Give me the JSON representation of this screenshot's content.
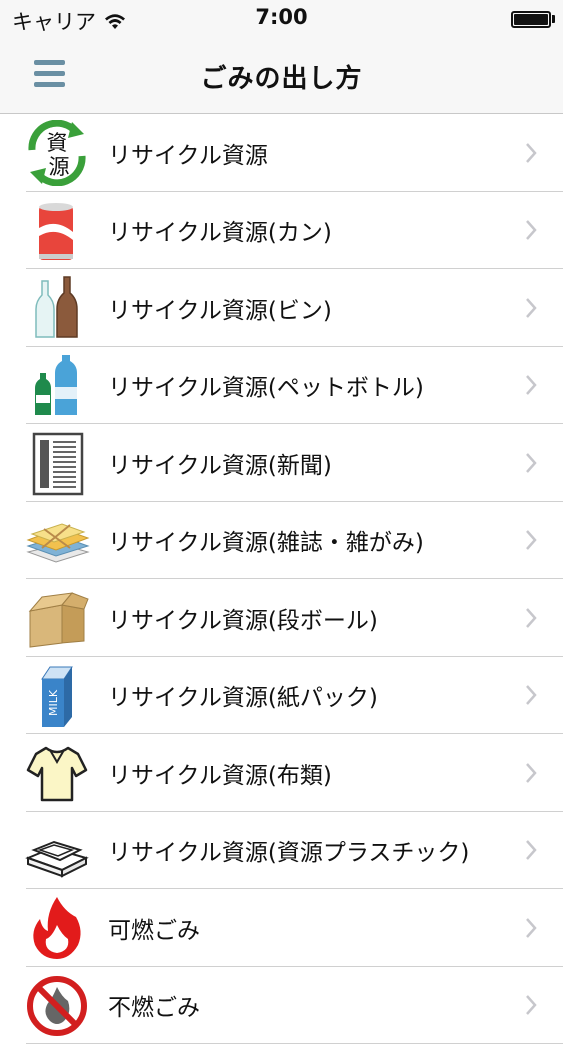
{
  "status": {
    "carrier": "キャリア",
    "time": "7:00"
  },
  "header": {
    "title": "ごみの出し方"
  },
  "items": [
    {
      "label": "リサイクル資源",
      "icon": "recycle-resource-icon"
    },
    {
      "label": "リサイクル資源(カン)",
      "icon": "can-icon"
    },
    {
      "label": "リサイクル資源(ビン)",
      "icon": "bottle-icon"
    },
    {
      "label": "リサイクル資源(ペットボトル)",
      "icon": "pet-bottle-icon"
    },
    {
      "label": "リサイクル資源(新聞)",
      "icon": "newspaper-icon"
    },
    {
      "label": "リサイクル資源(雑誌・雑がみ)",
      "icon": "magazine-icon"
    },
    {
      "label": "リサイクル資源(段ボール)",
      "icon": "cardboard-box-icon"
    },
    {
      "label": "リサイクル資源(紙パック)",
      "icon": "milk-carton-icon"
    },
    {
      "label": "リサイクル資源(布類)",
      "icon": "clothing-icon"
    },
    {
      "label": "リサイクル資源(資源プラスチック)",
      "icon": "plastic-tray-icon"
    },
    {
      "label": "可燃ごみ",
      "icon": "flame-icon"
    },
    {
      "label": "不燃ごみ",
      "icon": "no-burn-icon"
    }
  ],
  "colors": {
    "menu": "#6a8fa3",
    "chevron": "#c7c7cc"
  }
}
